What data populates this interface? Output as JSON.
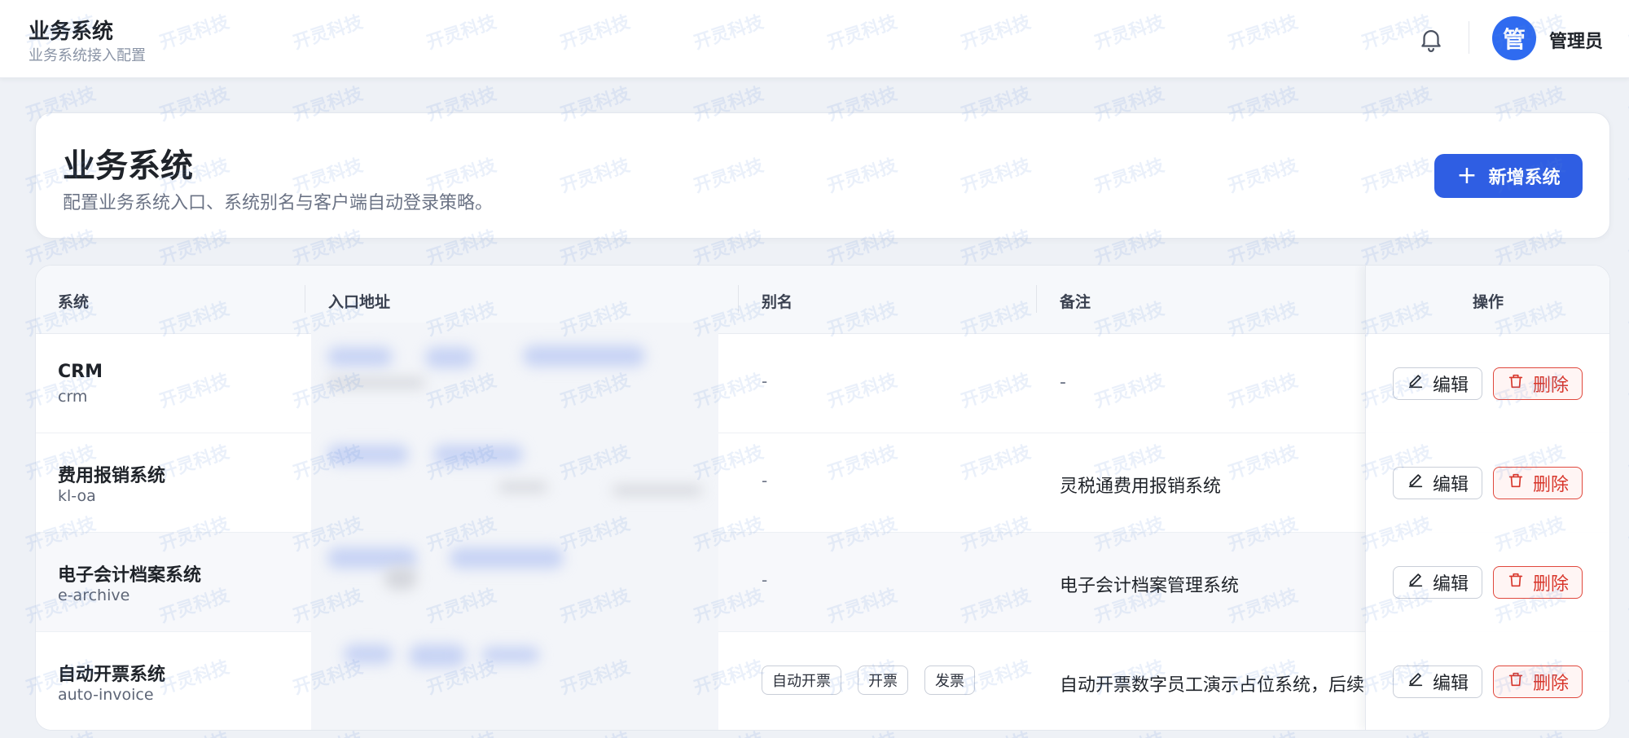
{
  "app": {
    "title": "业务系统",
    "subtitle": "业务系统接入配置",
    "user_avatar_text": "管",
    "user_name": "管理员",
    "watermark_text": "开灵科技"
  },
  "header": {
    "title": "业务系统",
    "description": "配置业务系统入口、系统别名与客户端自动登录策略。",
    "add_button_label": "新增系统",
    "add_button_icon": "plus-icon"
  },
  "table": {
    "columns": [
      "系统",
      "入口地址",
      "别名",
      "备注",
      "操作"
    ],
    "rows": [
      {
        "name": "CRM",
        "code": "crm",
        "alias": "-",
        "aliases": [],
        "remark": "-"
      },
      {
        "name": "费用报销系统",
        "code": "kl-oa",
        "alias": "-",
        "aliases": [],
        "remark": "灵税通费用报销系统"
      },
      {
        "name": "电子会计档案系统",
        "code": "e-archive",
        "alias": "-",
        "aliases": [],
        "remark": "电子会计档案管理系统"
      },
      {
        "name": "自动开票系统",
        "code": "auto-invoice",
        "alias": "",
        "aliases": [
          "自动开票",
          "开票",
          "发票"
        ],
        "remark": "自动开票数字员工演示占位系统，后续"
      }
    ],
    "actions": {
      "edit_label": "编辑",
      "delete_label": "删除"
    }
  },
  "colors": {
    "primary": "#2f5ee3",
    "danger": "#d8362b",
    "background": "#eef1f6"
  }
}
